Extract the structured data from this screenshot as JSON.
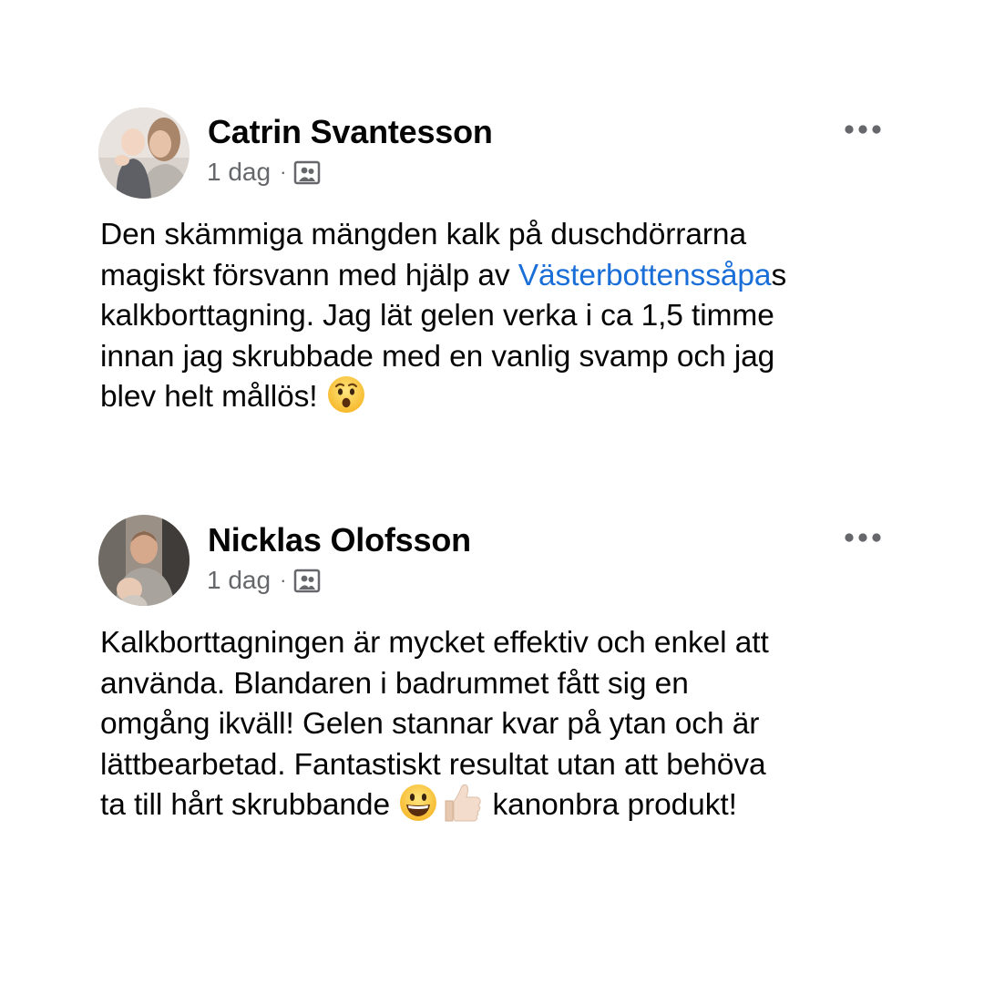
{
  "posts": [
    {
      "author": "Catrin Svantesson",
      "timestamp": "1 dag",
      "separator": "·",
      "audience_icon": "photo-album-icon",
      "more_icon": "more-options-icon",
      "body": {
        "line1": "Den skämmiga mängden kalk på duschdörrarna",
        "line2_before": "magiskt försvann med hjälp av ",
        "line2_link": "Västerbottenssåpa",
        "line2_after": "s",
        "line3": "kalkborttagning. Jag lät gelen verka i ca 1,5 timme",
        "line4": "innan jag skrubbade med en vanlig svamp och jag",
        "line5": "blev helt mållös!",
        "emoji": "hushed-face-emoji"
      }
    },
    {
      "author": "Nicklas Olofsson",
      "timestamp": "1 dag",
      "separator": "·",
      "audience_icon": "photo-album-icon",
      "more_icon": "more-options-icon",
      "body": {
        "line1": "Kalkborttagningen är mycket effektiv och enkel att",
        "line2": "använda. Blandaren i badrummet fått sig en",
        "line3": "omgång ikväll! Gelen stannar kvar på ytan och är",
        "line4": "lättbearbetad. Fantastiskt resultat utan att behöva",
        "line5_before": "ta till hårt skrubbande",
        "line5_after": "kanonbra produkt!",
        "emojis": [
          "grinning-face-emoji",
          "thumbs-up-emoji"
        ]
      }
    }
  ],
  "colors": {
    "text": "#050505",
    "meta": "#65676b",
    "link": "#1a6ed8",
    "background": "#ffffff"
  }
}
